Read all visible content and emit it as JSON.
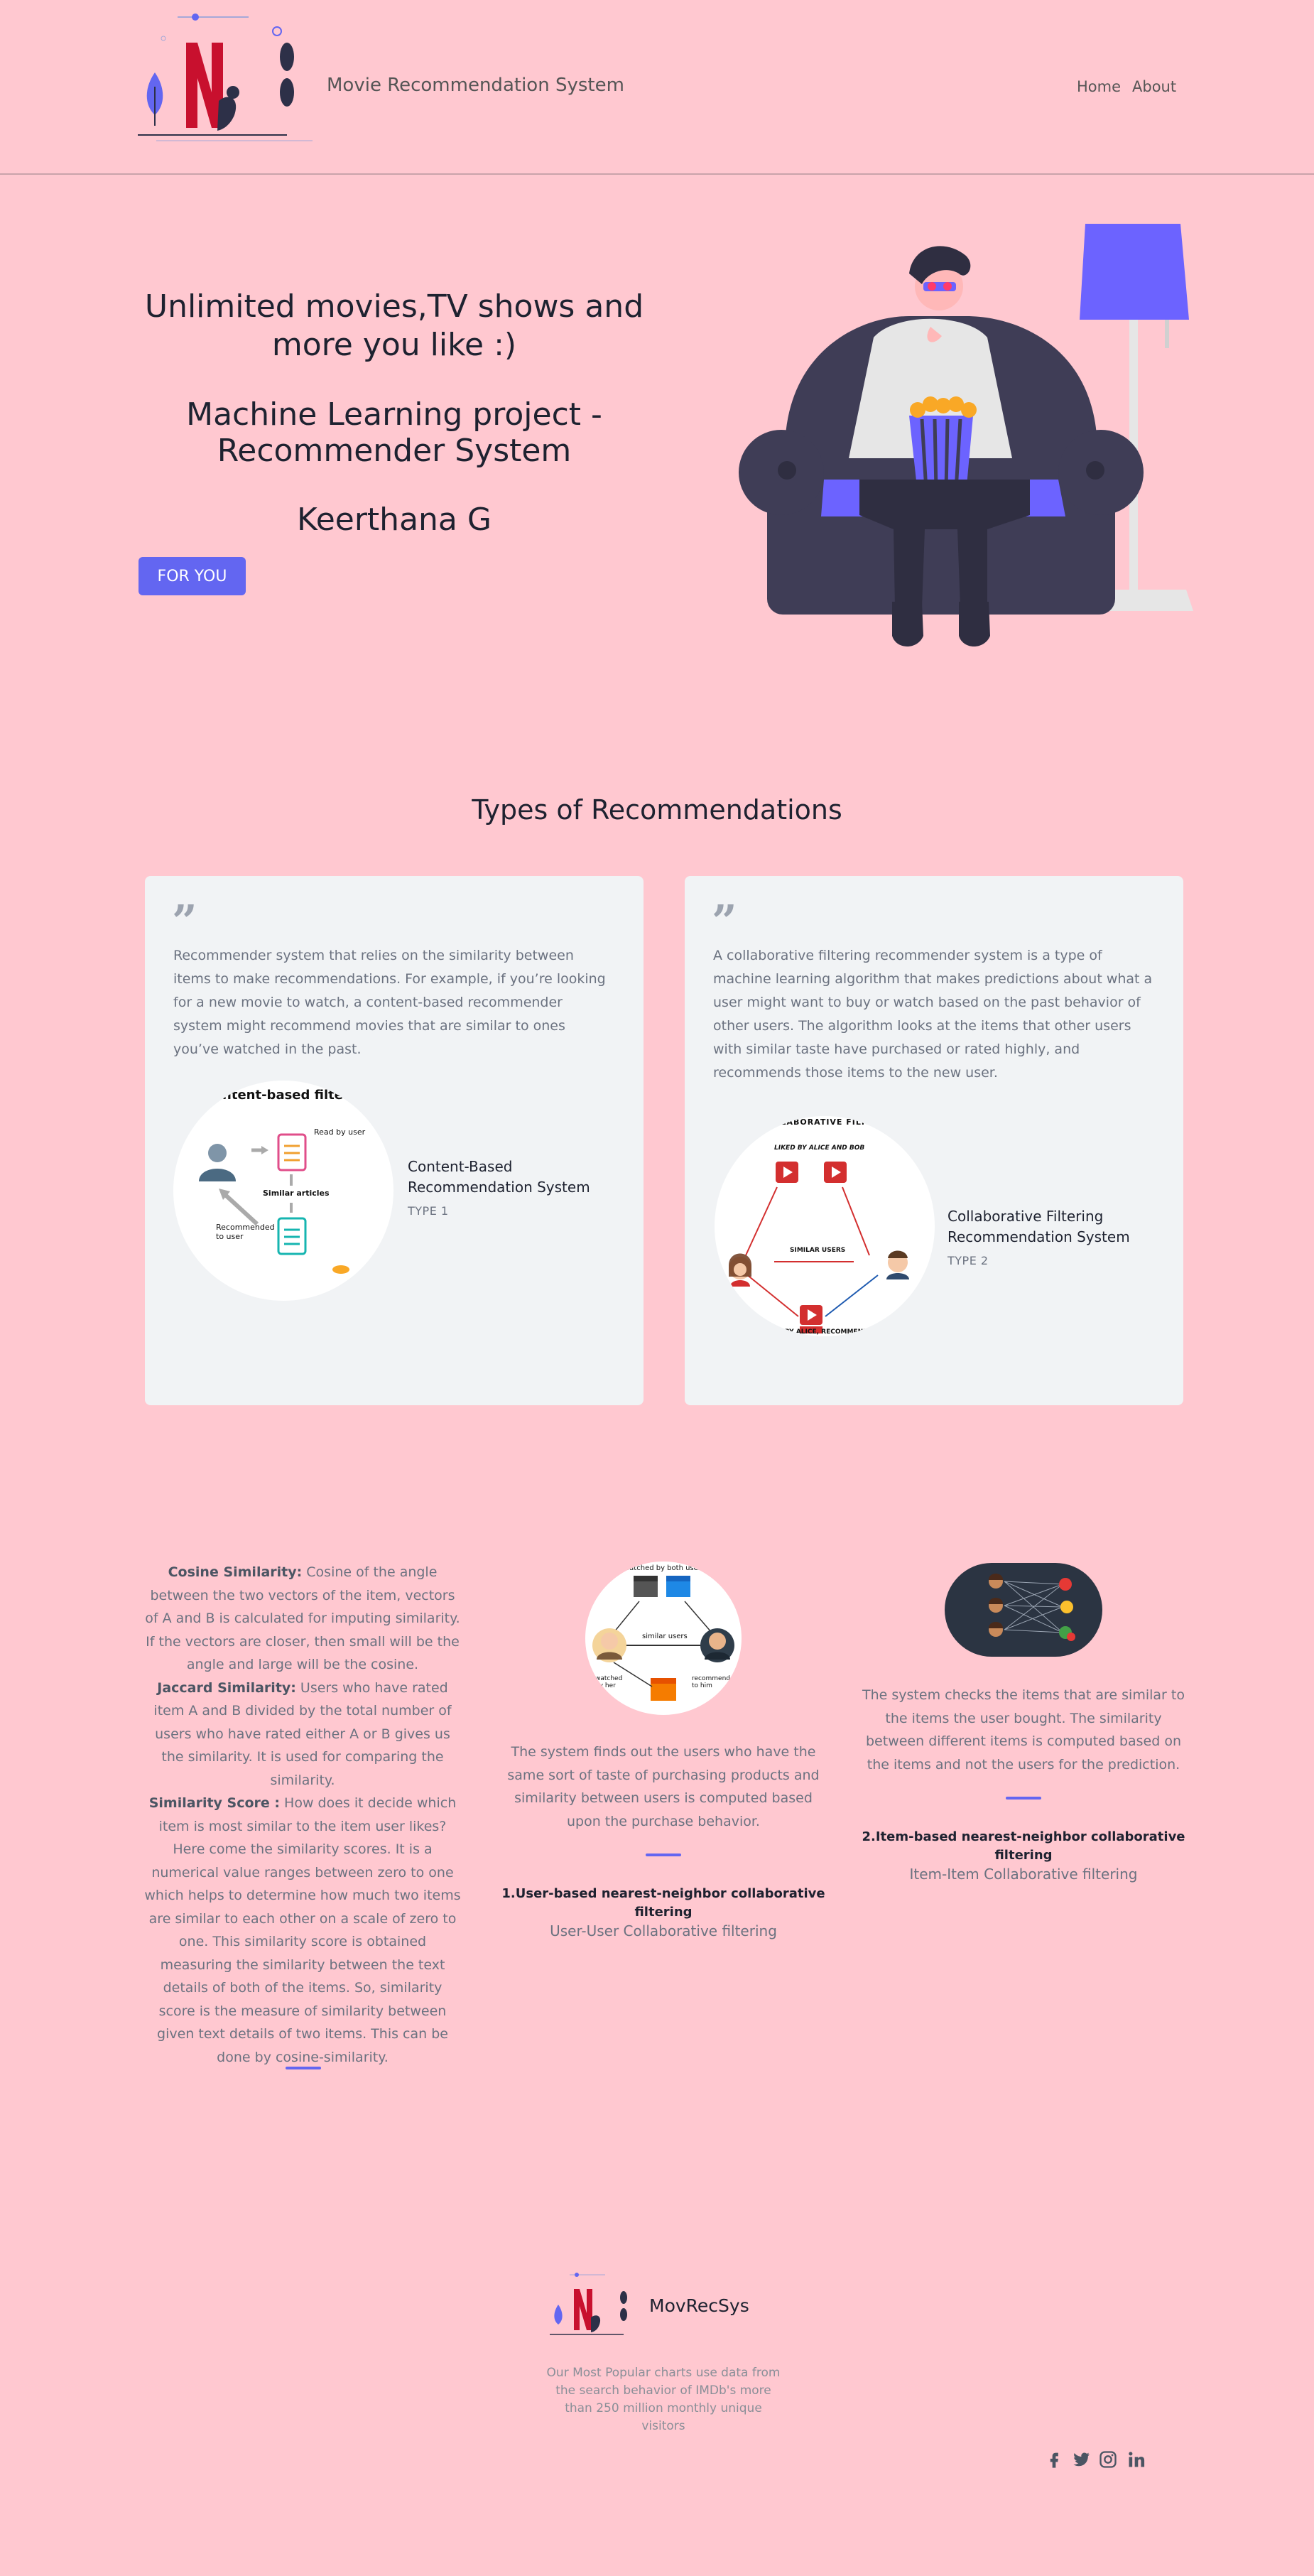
{
  "header": {
    "site_title": "Movie Recommendation System",
    "nav": {
      "home": "Home",
      "about": "About"
    }
  },
  "hero": {
    "line1": "Unlimited movies,TV shows and",
    "line2": "more you like :)",
    "line3": "Machine Learning project -",
    "line4": "Recommender System",
    "author": "Keerthana G",
    "button": "FOR YOU"
  },
  "types": {
    "title": "Types of Recommendations",
    "cards": [
      {
        "text": "Recommender system that relies on the similarity between items to make recommendations. For example, if you’re looking for a new movie to watch, a content-based recommender system might recommend movies that are similar to ones you’ve watched in the past.",
        "name": "Content-Based Recommendation System",
        "type": "TYPE 1",
        "img": {
          "title": "content-based filtering",
          "read": "Read by user",
          "similar": "Similar articles",
          "recommended": "Recommended to user"
        }
      },
      {
        "text": "A collaborative filtering recommender system is a type of machine learning algorithm that makes predictions about what a user might want to buy or watch based on the past behavior of other users. The algorithm looks at the items that other users with similar taste have purchased or rated highly, and recommends those items to the new user.",
        "name": "Collaborative Filtering Recommendation System",
        "type": "TYPE 2",
        "img": {
          "title": "COLLABORATIVE FILTERING",
          "liked": "LIKED BY ALICE AND BOB",
          "similar": "SIMILAR USERS",
          "bottom": "LIKED BY ALICE, RECOMMENDED TO BOB"
        }
      }
    ]
  },
  "info": {
    "col1": {
      "cosine_label": "Cosine Similarity:",
      "cosine_text": " Cosine of the angle between the two vectors of the item, vectors of A and B is calculated for imputing similarity. If the vectors are closer, then small will be the angle and large will be the cosine.",
      "jaccard_label": "Jaccard Similarity:",
      "jaccard_text": " Users who have rated item A and B divided by the total number of users who have rated either A or B gives us the similarity. It is used for comparing the similarity.",
      "score_label": "Similarity Score :",
      "score_text": " How does it decide which item is most similar to the item user likes? Here come the similarity scores. It is a numerical value ranges between zero to one which helps to determine how much two items are similar to each other on a scale of zero to one. This similarity score is obtained measuring the similarity between the text details of both of the items. So, similarity score is the measure of similarity between given text details of two items. This can be done by cosine-similarity."
    },
    "col2": {
      "text": "The system finds out the users who have the same sort of taste of purchasing products and similarity between users is computed based upon the purchase behavior.",
      "heading": "1.User-based nearest-neighbor collaborative filtering",
      "sub": "User-User Collaborative filtering",
      "img": {
        "top": "watched by both users",
        "middle": "similar users",
        "left": "watched by her",
        "right": "recommended to him"
      }
    },
    "col3": {
      "text": "The system checks the items that are similar to the items the user bought. The similarity between different items is computed based on the items and not the users for the prediction.",
      "heading": "2.Item-based nearest-neighbor collaborative filtering",
      "sub": "Item-Item Collaborative filtering"
    }
  },
  "footer": {
    "brand": "MovRecSys",
    "description": "Our Most Popular charts use data from the search behavior of IMDb's more than 250 million monthly unique visitors"
  },
  "colors": {
    "background": "#ffc8d0",
    "accent": "#6366f1",
    "card": "#f1f3f5",
    "netflix_red": "#c8102e"
  }
}
